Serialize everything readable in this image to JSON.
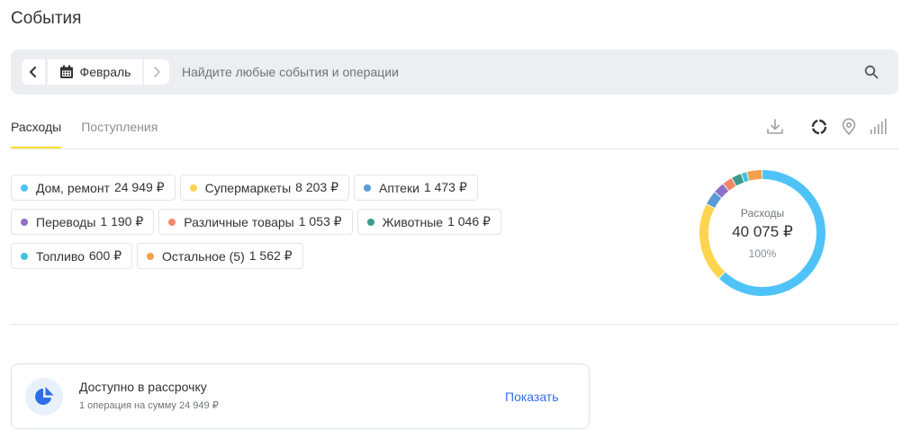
{
  "page": {
    "title": "События"
  },
  "search": {
    "month": "Февраль",
    "placeholder": "Найдите любые события и операции"
  },
  "tabs": [
    {
      "label": "Расходы",
      "active": true
    },
    {
      "label": "Поступления",
      "active": false
    }
  ],
  "toolbar_icons": [
    "download-icon",
    "donut-chart-icon",
    "map-pin-icon",
    "bar-chart-icon"
  ],
  "categories": [
    {
      "label": "Дом, ремонт",
      "amount": "24 949 ₽",
      "color": "#4fc3f7"
    },
    {
      "label": "Супермаркеты",
      "amount": "8 203 ₽",
      "color": "#ffd54f"
    },
    {
      "label": "Аптеки",
      "amount": "1 473 ₽",
      "color": "#5c9bd6"
    },
    {
      "label": "Переводы",
      "amount": "1 190 ₽",
      "color": "#8e6fc9"
    },
    {
      "label": "Различные товары",
      "amount": "1 053 ₽",
      "color": "#f0876a"
    },
    {
      "label": "Животные",
      "amount": "1 046 ₽",
      "color": "#3f9a8e"
    },
    {
      "label": "Топливо",
      "amount": "600 ₽",
      "color": "#40c4dc"
    },
    {
      "label": "Остальное (5)",
      "amount": "1 562 ₽",
      "color": "#f4a04e"
    }
  ],
  "chart_data": {
    "type": "pie",
    "categories": [
      "Дом, ремонт",
      "Супермаркеты",
      "Аптеки",
      "Переводы",
      "Различные товары",
      "Животные",
      "Топливо",
      "Остальное (5)"
    ],
    "values": [
      24949,
      8203,
      1473,
      1190,
      1053,
      1046,
      600,
      1562
    ],
    "colors": [
      "#4fc3f7",
      "#ffd54f",
      "#5c9bd6",
      "#8e6fc9",
      "#f0876a",
      "#3f9a8e",
      "#40c4dc",
      "#f4a04e"
    ],
    "center_label": "Расходы",
    "total": "40 075 ₽",
    "percent": "100%"
  },
  "installment": {
    "title": "Доступно в рассрочку",
    "subtitle": "1 операция на сумму 24 949 ₽",
    "action": "Показать"
  }
}
